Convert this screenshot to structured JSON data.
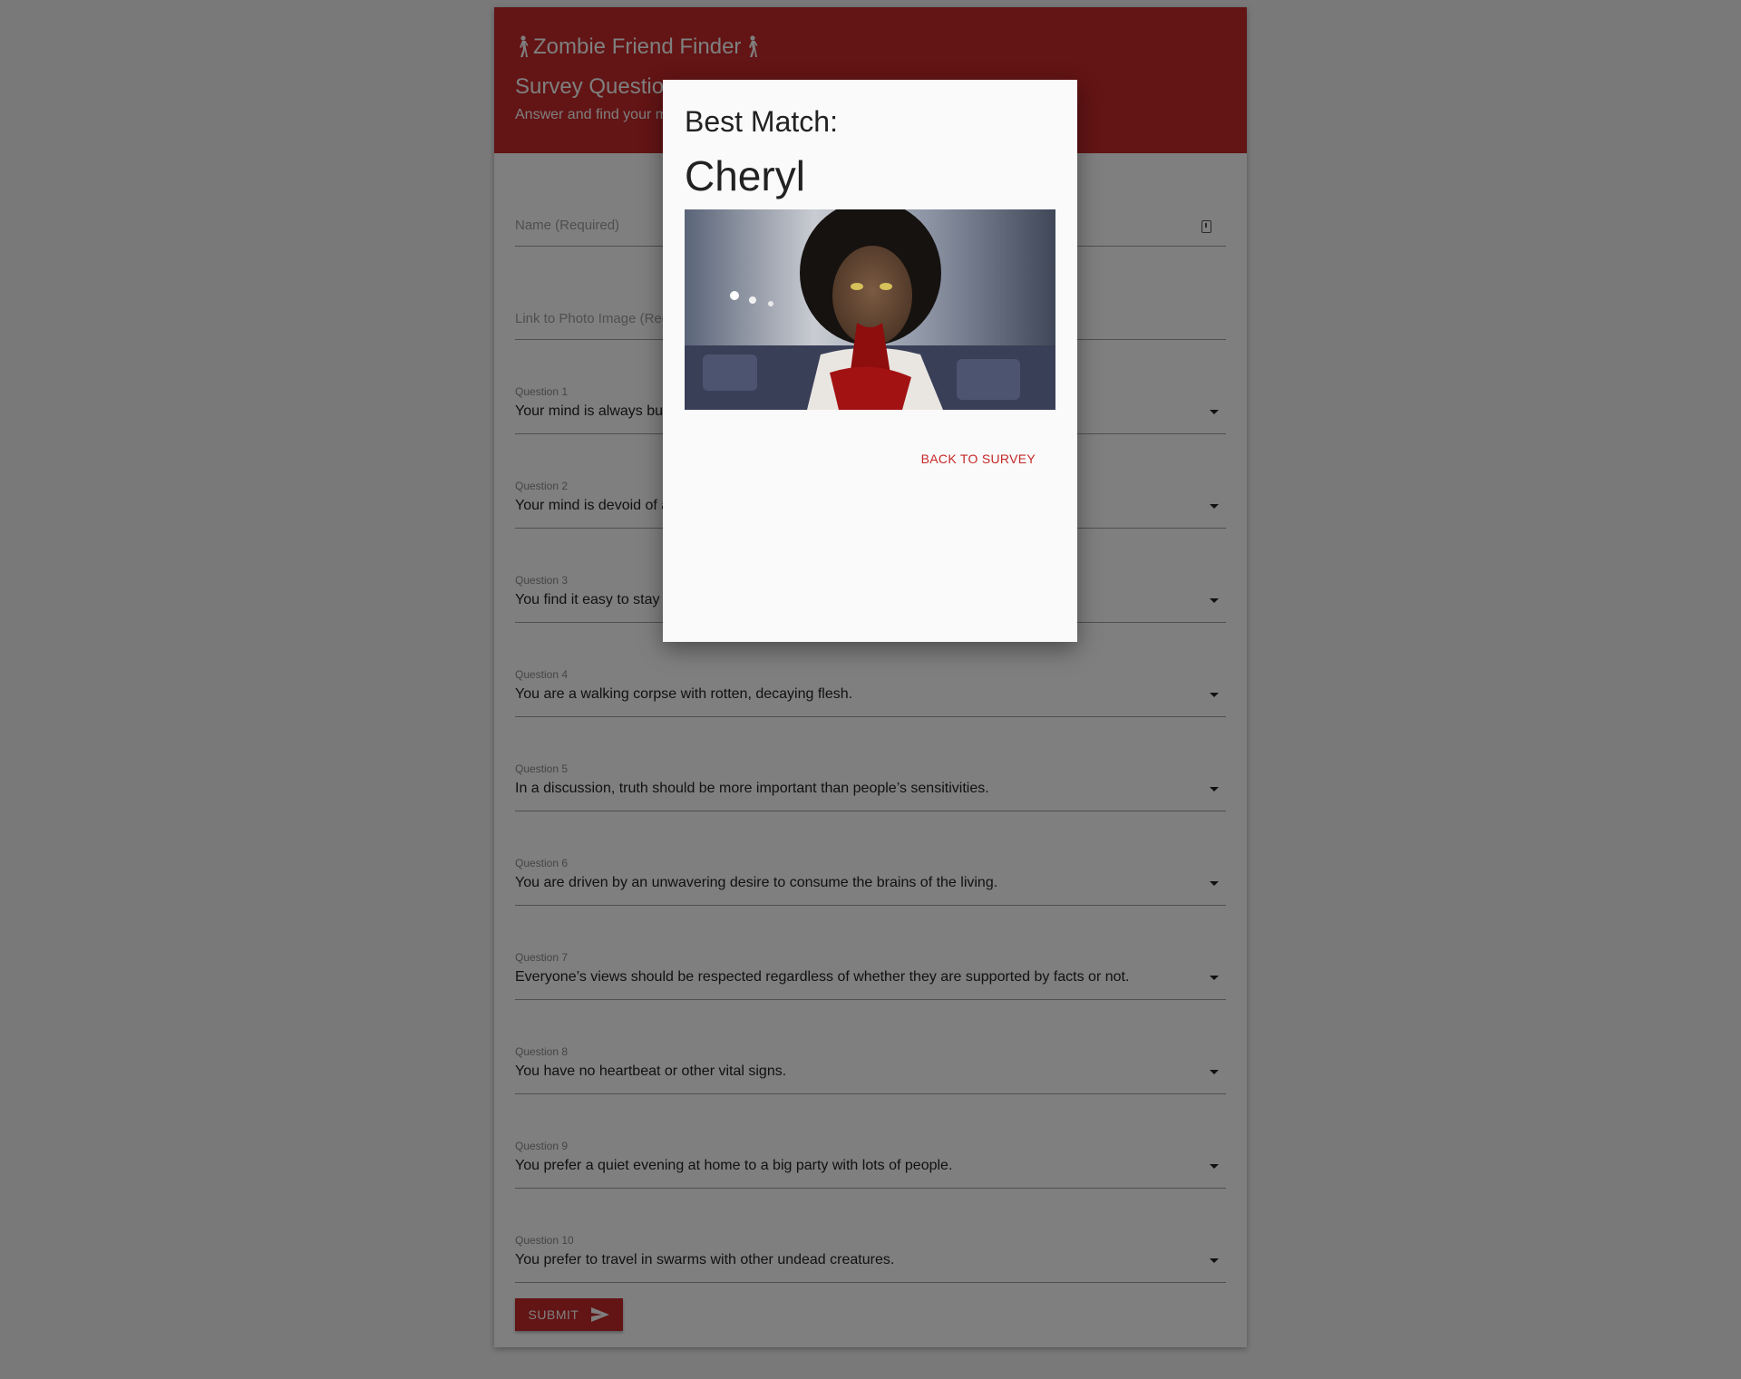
{
  "header": {
    "app_title": "Zombie Friend Finder",
    "survey_title": "Survey Questions",
    "survey_subtitle": "Answer and find your match"
  },
  "form": {
    "name_placeholder": "Name (Required)",
    "photo_placeholder": "Link to Photo Image (Required)",
    "questions": [
      {
        "label": "Question 1",
        "value": "Your mind is always buzzing with unexplored ideas and plans."
      },
      {
        "label": "Question 2",
        "value": "Your mind is devoid of all thought except for the hunger for human flesh."
      },
      {
        "label": "Question 3",
        "value": "You find it easy to stay relaxed even when there is some pressure."
      },
      {
        "label": "Question 4",
        "value": "You are a walking corpse with rotten, decaying flesh."
      },
      {
        "label": "Question 5",
        "value": "In a discussion, truth should be more important than people’s sensitivities."
      },
      {
        "label": "Question 6",
        "value": "You are driven by an unwavering desire to consume the brains of the living."
      },
      {
        "label": "Question 7",
        "value": "Everyone’s views should be respected regardless of whether they are supported by facts or not."
      },
      {
        "label": "Question 8",
        "value": "You have no heartbeat or other vital signs."
      },
      {
        "label": "Question 9",
        "value": "You prefer a quiet evening at home to a big party with lots of people."
      },
      {
        "label": "Question 10",
        "value": "You prefer to travel in swarms with other undead creatures."
      }
    ],
    "submit_label": "SUBMIT"
  },
  "modal": {
    "heading": "Best Match:",
    "match_name": "Cheryl",
    "back_label": "BACK TO SURVEY"
  },
  "colors": {
    "accent": "#c62828",
    "overlay": "rgba(0,0,0,0.5)"
  },
  "icons": [
    "walking-person-icon",
    "form-field-icon",
    "dropdown-caret-icon",
    "send-icon"
  ]
}
